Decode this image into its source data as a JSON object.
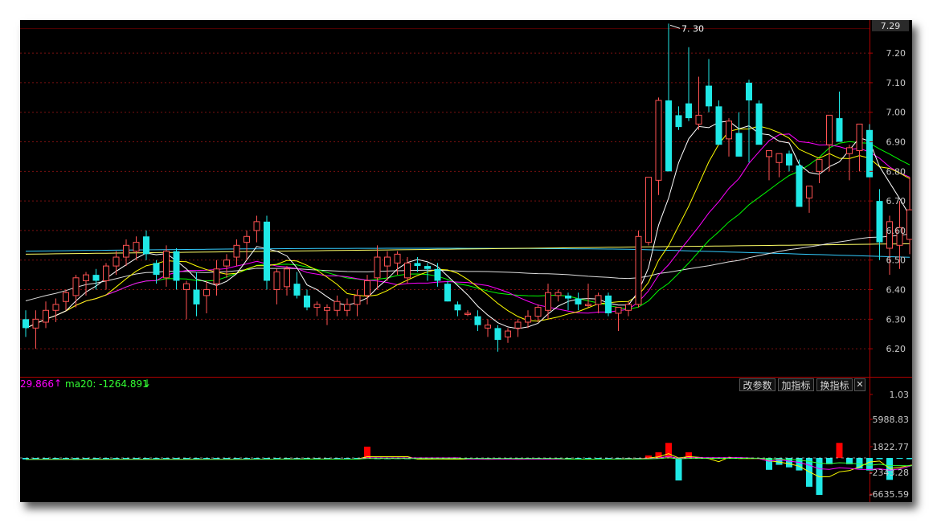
{
  "colors": {
    "background": "#000000",
    "up": "#ff5252",
    "down": "#1fe8e6",
    "grid": "#7a1111",
    "axis_text": "#c8c8c8",
    "ma5": "#ffffff",
    "ma10": "#ffff00",
    "ma20": "#ff00ff",
    "ma30": "#00ff00",
    "ma60": "#ffffff",
    "ma120": "#ffff66",
    "ma250": "#33ccff"
  },
  "price_axis": {
    "top_value": "7.29",
    "ticks": [
      "7.20",
      "7.10",
      "7.00",
      "6.90",
      "6.80",
      "6.70",
      "6.60",
      "6.50",
      "6.40",
      "6.30",
      "6.20"
    ]
  },
  "high_marker": "7. 30",
  "indicator": {
    "legend_a": "29.866",
    "legend_a_arrow": "↑",
    "legend_b": "ma20: -1264.891",
    "legend_b_arrow": "↓",
    "buttons": [
      "改参数",
      "加指标",
      "换指标"
    ],
    "close_icon": "close-icon",
    "axis_ticks": [
      "1.03",
      "5988.83",
      "1822.77",
      "-2343.28",
      "-6635.59"
    ]
  },
  "chart_data": {
    "type": "candlestick",
    "ylim": [
      6.17,
      7.3
    ],
    "grid": true,
    "ohlc": [
      [
        6.3,
        6.33,
        6.24,
        6.27
      ],
      [
        6.27,
        6.33,
        6.2,
        6.3
      ],
      [
        6.29,
        6.36,
        6.27,
        6.33
      ],
      [
        6.33,
        6.37,
        6.29,
        6.35
      ],
      [
        6.36,
        6.4,
        6.33,
        6.39
      ],
      [
        6.38,
        6.45,
        6.34,
        6.44
      ],
      [
        6.43,
        6.46,
        6.38,
        6.45
      ],
      [
        6.45,
        6.47,
        6.4,
        6.43
      ],
      [
        6.43,
        6.49,
        6.4,
        6.48
      ],
      [
        6.48,
        6.53,
        6.45,
        6.51
      ],
      [
        6.51,
        6.57,
        6.48,
        6.55
      ],
      [
        6.53,
        6.58,
        6.5,
        6.56
      ],
      [
        6.58,
        6.6,
        6.5,
        6.52
      ],
      [
        6.49,
        6.5,
        6.42,
        6.45
      ],
      [
        6.44,
        6.55,
        6.41,
        6.53
      ],
      [
        6.53,
        6.54,
        6.4,
        6.43
      ],
      [
        6.4,
        6.43,
        6.3,
        6.42
      ],
      [
        6.4,
        6.46,
        6.31,
        6.35
      ],
      [
        6.38,
        6.43,
        6.32,
        6.4
      ],
      [
        6.42,
        6.5,
        6.38,
        6.47
      ],
      [
        6.48,
        6.52,
        6.44,
        6.5
      ],
      [
        6.51,
        6.57,
        6.48,
        6.55
      ],
      [
        6.56,
        6.6,
        6.5,
        6.58
      ],
      [
        6.6,
        6.65,
        6.56,
        6.63
      ],
      [
        6.63,
        6.65,
        6.4,
        6.43
      ],
      [
        6.4,
        6.47,
        6.35,
        6.46
      ],
      [
        6.41,
        6.48,
        6.38,
        6.47
      ],
      [
        6.42,
        6.46,
        6.37,
        6.38
      ],
      [
        6.38,
        6.4,
        6.33,
        6.34
      ],
      [
        6.34,
        6.36,
        6.31,
        6.35
      ],
      [
        6.33,
        6.35,
        6.28,
        6.34
      ],
      [
        6.33,
        6.38,
        6.31,
        6.36
      ],
      [
        6.33,
        6.37,
        6.31,
        6.35
      ],
      [
        6.35,
        6.4,
        6.31,
        6.38
      ],
      [
        6.38,
        6.45,
        6.35,
        6.43
      ],
      [
        6.44,
        6.55,
        6.4,
        6.51
      ],
      [
        6.48,
        6.53,
        6.43,
        6.51
      ],
      [
        6.49,
        6.53,
        6.45,
        6.52
      ],
      [
        6.44,
        6.51,
        6.42,
        6.49
      ],
      [
        6.49,
        6.51,
        6.46,
        6.48
      ],
      [
        6.48,
        6.49,
        6.43,
        6.47
      ],
      [
        6.47,
        6.49,
        6.41,
        6.43
      ],
      [
        6.42,
        6.43,
        6.36,
        6.36
      ],
      [
        6.35,
        6.36,
        6.31,
        6.33
      ],
      [
        6.32,
        6.33,
        6.31,
        6.32
      ],
      [
        6.31,
        6.33,
        6.26,
        6.28
      ],
      [
        6.27,
        6.3,
        6.24,
        6.28
      ],
      [
        6.27,
        6.28,
        6.19,
        6.23
      ],
      [
        6.24,
        6.27,
        6.22,
        6.26
      ],
      [
        6.27,
        6.3,
        6.24,
        6.29
      ],
      [
        6.29,
        6.33,
        6.27,
        6.31
      ],
      [
        6.31,
        6.35,
        6.29,
        6.34
      ],
      [
        6.33,
        6.42,
        6.3,
        6.39
      ],
      [
        6.38,
        6.4,
        6.36,
        6.39
      ],
      [
        6.38,
        6.39,
        6.33,
        6.37
      ],
      [
        6.37,
        6.39,
        6.33,
        6.35
      ],
      [
        6.35,
        6.42,
        6.34,
        6.35
      ],
      [
        6.35,
        6.39,
        6.32,
        6.38
      ],
      [
        6.38,
        6.39,
        6.31,
        6.32
      ],
      [
        6.32,
        6.34,
        6.26,
        6.34
      ],
      [
        6.33,
        6.36,
        6.31,
        6.35
      ],
      [
        6.35,
        6.6,
        6.34,
        6.58
      ],
      [
        6.56,
        6.72,
        6.55,
        6.78
      ],
      [
        6.77,
        7.05,
        6.72,
        7.04
      ],
      [
        7.04,
        7.3,
        6.88,
        6.8
      ],
      [
        6.99,
        7.02,
        6.94,
        6.95
      ],
      [
        7.03,
        7.22,
        6.97,
        6.98
      ],
      [
        6.96,
        7.12,
        6.94,
        6.99
      ],
      [
        7.09,
        7.18,
        7.0,
        7.02
      ],
      [
        7.02,
        7.04,
        6.9,
        6.89
      ],
      [
        6.91,
        6.98,
        6.85,
        6.97
      ],
      [
        6.93,
        7.0,
        6.87,
        6.85
      ],
      [
        7.1,
        7.11,
        6.83,
        7.04
      ],
      [
        7.03,
        7.04,
        6.95,
        6.89
      ],
      [
        6.85,
        6.87,
        6.77,
        6.87
      ],
      [
        6.83,
        6.85,
        6.78,
        6.86
      ],
      [
        6.86,
        6.87,
        6.8,
        6.82
      ],
      [
        6.82,
        6.84,
        6.72,
        6.68
      ],
      [
        6.71,
        6.74,
        6.66,
        6.75
      ],
      [
        6.8,
        6.82,
        6.76,
        6.84
      ],
      [
        6.89,
        6.97,
        6.8,
        6.99
      ],
      [
        6.98,
        7.07,
        6.92,
        6.9
      ],
      [
        6.86,
        6.89,
        6.77,
        6.88
      ],
      [
        6.87,
        6.93,
        6.8,
        6.96
      ],
      [
        6.94,
        6.96,
        6.78,
        6.78
      ],
      [
        6.7,
        6.74,
        6.5,
        6.56
      ],
      [
        6.54,
        6.65,
        6.45,
        6.63
      ],
      [
        6.55,
        6.7,
        6.47,
        6.61
      ],
      [
        6.57,
        6.78,
        6.52,
        6.67
      ]
    ],
    "indicator_bars": [
      -240,
      -210,
      -200,
      -230,
      -180,
      -330,
      -200,
      -210,
      -220,
      -220,
      -200,
      -190,
      -260,
      -210,
      -190,
      -220,
      -200,
      -230,
      -180,
      -200,
      -210,
      -180,
      -200,
      -200,
      -180,
      -170,
      -160,
      -170,
      -200,
      -180,
      -170,
      -210,
      -200,
      -230,
      1800,
      -200,
      -200,
      -180,
      -200,
      -190,
      -180,
      -170,
      -210,
      -200,
      -180,
      -190,
      -220,
      -200,
      -200,
      -190,
      -160,
      -160,
      -170,
      -150,
      -220,
      -260,
      -200,
      -160,
      -140,
      -120,
      -100,
      -180,
      400,
      900,
      2400,
      -3600,
      900,
      -120,
      -100,
      -100,
      -80,
      -80,
      -100,
      -90,
      -1900,
      -1100,
      -1500,
      -2000,
      -4600,
      -5900,
      -1000,
      2400,
      -1000,
      -1700,
      -2000,
      -200,
      -3500,
      -100,
      -200,
      -500
    ]
  }
}
